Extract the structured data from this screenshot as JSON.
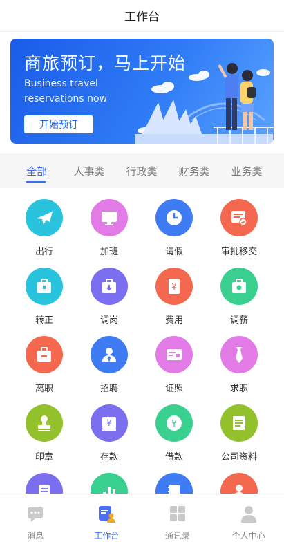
{
  "header": {
    "title": "工作台"
  },
  "banner": {
    "title": "商旅预订，马上开始",
    "subtitle_line1": "Business travel",
    "subtitle_line2": "reservations now",
    "button_label": "开始预订"
  },
  "tabs": [
    {
      "label": "全部",
      "active": true
    },
    {
      "label": "人事类",
      "active": false
    },
    {
      "label": "行政类",
      "active": false
    },
    {
      "label": "财务类",
      "active": false
    },
    {
      "label": "业务类",
      "active": false
    }
  ],
  "apps": [
    {
      "label": "出行",
      "icon": "airplane-icon",
      "color": "#29c3de"
    },
    {
      "label": "加班",
      "icon": "monitor-icon",
      "color": "#e27be6"
    },
    {
      "label": "请假",
      "icon": "clock-icon",
      "color": "#3f7cf3"
    },
    {
      "label": "审批移交",
      "icon": "approval-transfer-icon",
      "color": "#f4684f"
    },
    {
      "label": "转正",
      "icon": "briefcase-icon",
      "color": "#29c3de"
    },
    {
      "label": "调岗",
      "icon": "transfer-box-icon",
      "color": "#7b6ff0"
    },
    {
      "label": "费用",
      "icon": "expense-icon",
      "color": "#f4684f"
    },
    {
      "label": "调薪",
      "icon": "salary-bag-icon",
      "color": "#39cf8f"
    },
    {
      "label": "离职",
      "icon": "resign-bag-icon",
      "color": "#f4684f"
    },
    {
      "label": "招聘",
      "icon": "recruit-person-icon",
      "color": "#3f7cf3"
    },
    {
      "label": "证照",
      "icon": "license-card-icon",
      "color": "#e27be6"
    },
    {
      "label": "求职",
      "icon": "tie-icon",
      "color": "#e27be6"
    },
    {
      "label": "印章",
      "icon": "seal-stamp-icon",
      "color": "#92c12b"
    },
    {
      "label": "存款",
      "icon": "deposit-icon",
      "color": "#7b6ff0"
    },
    {
      "label": "借款",
      "icon": "loan-yen-icon",
      "color": "#39cf8f"
    },
    {
      "label": "公司资料",
      "icon": "company-docs-icon",
      "color": "#92c12b"
    },
    {
      "label": "",
      "icon": "document-icon",
      "color": "#7b6ff0"
    },
    {
      "label": "",
      "icon": "bar-chart-icon",
      "color": "#39cf8f"
    },
    {
      "label": "",
      "icon": "notebook-icon",
      "color": "#3f7cf3"
    },
    {
      "label": "",
      "icon": "person-icon",
      "color": "#f4684f"
    }
  ],
  "bottom_nav": [
    {
      "label": "消息",
      "icon": "message-icon",
      "active": false
    },
    {
      "label": "工作台",
      "icon": "workbench-icon",
      "active": true
    },
    {
      "label": "通讯录",
      "icon": "contacts-grid-icon",
      "active": false
    },
    {
      "label": "个人中心",
      "icon": "profile-icon",
      "active": false
    }
  ],
  "colors": {
    "accent": "#3b6ff3",
    "banner_blue": "#1f5fe6"
  }
}
